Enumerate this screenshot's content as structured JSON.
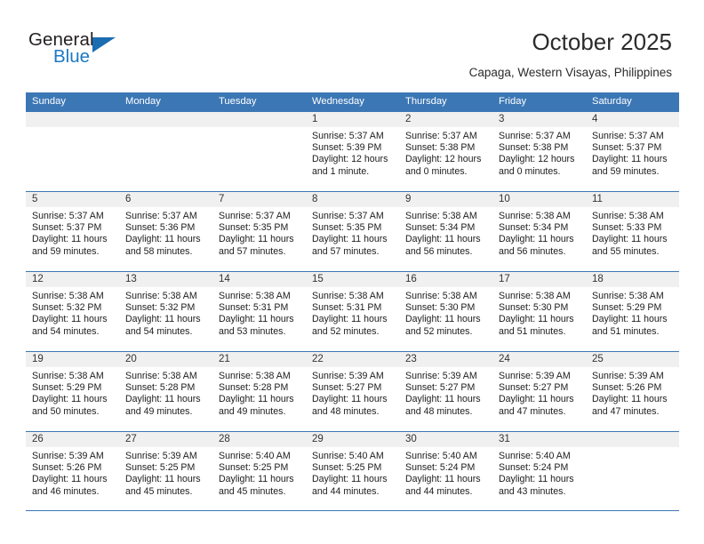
{
  "brand": {
    "name_top": "General",
    "name_bottom": "Blue",
    "accent_color": "#1b6cb0",
    "triangle_icon": "triangle-icon"
  },
  "header": {
    "title": "October 2025",
    "subtitle": "Capaga, Western Visayas, Philippines"
  },
  "theme": {
    "header_blue": "#3c77b5",
    "band_gray": "#f0f0f0",
    "text": "#1c1c1c"
  },
  "calendar": {
    "day_names": [
      "Sunday",
      "Monday",
      "Tuesday",
      "Wednesday",
      "Thursday",
      "Friday",
      "Saturday"
    ],
    "weeks": [
      [
        {
          "day": "",
          "sunrise": "",
          "sunset": "",
          "daylight_1": "",
          "daylight_2": ""
        },
        {
          "day": "",
          "sunrise": "",
          "sunset": "",
          "daylight_1": "",
          "daylight_2": ""
        },
        {
          "day": "",
          "sunrise": "",
          "sunset": "",
          "daylight_1": "",
          "daylight_2": ""
        },
        {
          "day": "1",
          "sunrise": "Sunrise: 5:37 AM",
          "sunset": "Sunset: 5:39 PM",
          "daylight_1": "Daylight: 12 hours",
          "daylight_2": "and 1 minute."
        },
        {
          "day": "2",
          "sunrise": "Sunrise: 5:37 AM",
          "sunset": "Sunset: 5:38 PM",
          "daylight_1": "Daylight: 12 hours",
          "daylight_2": "and 0 minutes."
        },
        {
          "day": "3",
          "sunrise": "Sunrise: 5:37 AM",
          "sunset": "Sunset: 5:38 PM",
          "daylight_1": "Daylight: 12 hours",
          "daylight_2": "and 0 minutes."
        },
        {
          "day": "4",
          "sunrise": "Sunrise: 5:37 AM",
          "sunset": "Sunset: 5:37 PM",
          "daylight_1": "Daylight: 11 hours",
          "daylight_2": "and 59 minutes."
        }
      ],
      [
        {
          "day": "5",
          "sunrise": "Sunrise: 5:37 AM",
          "sunset": "Sunset: 5:37 PM",
          "daylight_1": "Daylight: 11 hours",
          "daylight_2": "and 59 minutes."
        },
        {
          "day": "6",
          "sunrise": "Sunrise: 5:37 AM",
          "sunset": "Sunset: 5:36 PM",
          "daylight_1": "Daylight: 11 hours",
          "daylight_2": "and 58 minutes."
        },
        {
          "day": "7",
          "sunrise": "Sunrise: 5:37 AM",
          "sunset": "Sunset: 5:35 PM",
          "daylight_1": "Daylight: 11 hours",
          "daylight_2": "and 57 minutes."
        },
        {
          "day": "8",
          "sunrise": "Sunrise: 5:37 AM",
          "sunset": "Sunset: 5:35 PM",
          "daylight_1": "Daylight: 11 hours",
          "daylight_2": "and 57 minutes."
        },
        {
          "day": "9",
          "sunrise": "Sunrise: 5:38 AM",
          "sunset": "Sunset: 5:34 PM",
          "daylight_1": "Daylight: 11 hours",
          "daylight_2": "and 56 minutes."
        },
        {
          "day": "10",
          "sunrise": "Sunrise: 5:38 AM",
          "sunset": "Sunset: 5:34 PM",
          "daylight_1": "Daylight: 11 hours",
          "daylight_2": "and 56 minutes."
        },
        {
          "day": "11",
          "sunrise": "Sunrise: 5:38 AM",
          "sunset": "Sunset: 5:33 PM",
          "daylight_1": "Daylight: 11 hours",
          "daylight_2": "and 55 minutes."
        }
      ],
      [
        {
          "day": "12",
          "sunrise": "Sunrise: 5:38 AM",
          "sunset": "Sunset: 5:32 PM",
          "daylight_1": "Daylight: 11 hours",
          "daylight_2": "and 54 minutes."
        },
        {
          "day": "13",
          "sunrise": "Sunrise: 5:38 AM",
          "sunset": "Sunset: 5:32 PM",
          "daylight_1": "Daylight: 11 hours",
          "daylight_2": "and 54 minutes."
        },
        {
          "day": "14",
          "sunrise": "Sunrise: 5:38 AM",
          "sunset": "Sunset: 5:31 PM",
          "daylight_1": "Daylight: 11 hours",
          "daylight_2": "and 53 minutes."
        },
        {
          "day": "15",
          "sunrise": "Sunrise: 5:38 AM",
          "sunset": "Sunset: 5:31 PM",
          "daylight_1": "Daylight: 11 hours",
          "daylight_2": "and 52 minutes."
        },
        {
          "day": "16",
          "sunrise": "Sunrise: 5:38 AM",
          "sunset": "Sunset: 5:30 PM",
          "daylight_1": "Daylight: 11 hours",
          "daylight_2": "and 52 minutes."
        },
        {
          "day": "17",
          "sunrise": "Sunrise: 5:38 AM",
          "sunset": "Sunset: 5:30 PM",
          "daylight_1": "Daylight: 11 hours",
          "daylight_2": "and 51 minutes."
        },
        {
          "day": "18",
          "sunrise": "Sunrise: 5:38 AM",
          "sunset": "Sunset: 5:29 PM",
          "daylight_1": "Daylight: 11 hours",
          "daylight_2": "and 51 minutes."
        }
      ],
      [
        {
          "day": "19",
          "sunrise": "Sunrise: 5:38 AM",
          "sunset": "Sunset: 5:29 PM",
          "daylight_1": "Daylight: 11 hours",
          "daylight_2": "and 50 minutes."
        },
        {
          "day": "20",
          "sunrise": "Sunrise: 5:38 AM",
          "sunset": "Sunset: 5:28 PM",
          "daylight_1": "Daylight: 11 hours",
          "daylight_2": "and 49 minutes."
        },
        {
          "day": "21",
          "sunrise": "Sunrise: 5:38 AM",
          "sunset": "Sunset: 5:28 PM",
          "daylight_1": "Daylight: 11 hours",
          "daylight_2": "and 49 minutes."
        },
        {
          "day": "22",
          "sunrise": "Sunrise: 5:39 AM",
          "sunset": "Sunset: 5:27 PM",
          "daylight_1": "Daylight: 11 hours",
          "daylight_2": "and 48 minutes."
        },
        {
          "day": "23",
          "sunrise": "Sunrise: 5:39 AM",
          "sunset": "Sunset: 5:27 PM",
          "daylight_1": "Daylight: 11 hours",
          "daylight_2": "and 48 minutes."
        },
        {
          "day": "24",
          "sunrise": "Sunrise: 5:39 AM",
          "sunset": "Sunset: 5:27 PM",
          "daylight_1": "Daylight: 11 hours",
          "daylight_2": "and 47 minutes."
        },
        {
          "day": "25",
          "sunrise": "Sunrise: 5:39 AM",
          "sunset": "Sunset: 5:26 PM",
          "daylight_1": "Daylight: 11 hours",
          "daylight_2": "and 47 minutes."
        }
      ],
      [
        {
          "day": "26",
          "sunrise": "Sunrise: 5:39 AM",
          "sunset": "Sunset: 5:26 PM",
          "daylight_1": "Daylight: 11 hours",
          "daylight_2": "and 46 minutes."
        },
        {
          "day": "27",
          "sunrise": "Sunrise: 5:39 AM",
          "sunset": "Sunset: 5:25 PM",
          "daylight_1": "Daylight: 11 hours",
          "daylight_2": "and 45 minutes."
        },
        {
          "day": "28",
          "sunrise": "Sunrise: 5:40 AM",
          "sunset": "Sunset: 5:25 PM",
          "daylight_1": "Daylight: 11 hours",
          "daylight_2": "and 45 minutes."
        },
        {
          "day": "29",
          "sunrise": "Sunrise: 5:40 AM",
          "sunset": "Sunset: 5:25 PM",
          "daylight_1": "Daylight: 11 hours",
          "daylight_2": "and 44 minutes."
        },
        {
          "day": "30",
          "sunrise": "Sunrise: 5:40 AM",
          "sunset": "Sunset: 5:24 PM",
          "daylight_1": "Daylight: 11 hours",
          "daylight_2": "and 44 minutes."
        },
        {
          "day": "31",
          "sunrise": "Sunrise: 5:40 AM",
          "sunset": "Sunset: 5:24 PM",
          "daylight_1": "Daylight: 11 hours",
          "daylight_2": "and 43 minutes."
        },
        {
          "day": "",
          "sunrise": "",
          "sunset": "",
          "daylight_1": "",
          "daylight_2": ""
        }
      ]
    ]
  }
}
